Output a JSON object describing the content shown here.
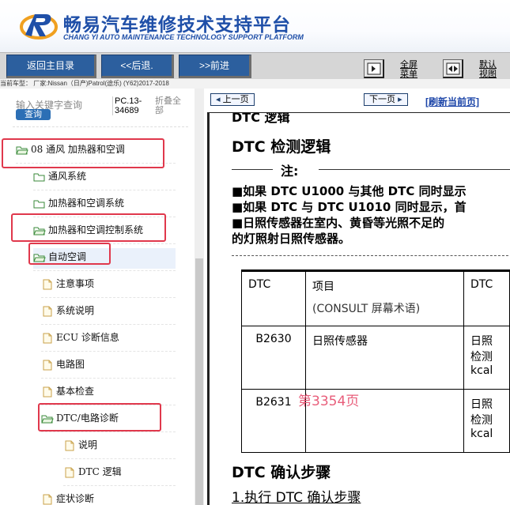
{
  "header": {
    "title": "畅易汽车维修技术支持平台",
    "subtitle": "CHANG YI AUTO MAINTENANCE TECHNOLOGY SUPPORT PLATFORM"
  },
  "toolbar": {
    "home_label": "返回主目录",
    "back_label": "<<后退.",
    "forward_label": ">>前进",
    "fullscreen_label": "全屏",
    "menu_label": "菜单",
    "default_label": "默认",
    "view_label": "视图"
  },
  "vehicle_info": "当前车型： 厂家:Nissan（日产)Patrol(途乐) (Y62)2017-2018",
  "search": {
    "placeholder": "输入关键字查询",
    "button_label": "查询"
  },
  "doc_code": "PC.13-34689",
  "collapse_label": "折叠全部",
  "tree": [
    {
      "label": "08 通风 加热器和空调",
      "level": 0,
      "open": true,
      "highlight": true
    },
    {
      "label": "通风系统",
      "level": 1,
      "open": false,
      "highlight": false
    },
    {
      "label": "加热器和空调系统",
      "level": 1,
      "open": false,
      "highlight": false
    },
    {
      "label": "加热器和空调控制系统",
      "level": 1,
      "open": true,
      "highlight": true
    },
    {
      "label": "自动空调",
      "level": 2,
      "open": true,
      "highlight": true,
      "selected": true
    },
    {
      "label": "注意事项",
      "level": 3,
      "file": true
    },
    {
      "label": "系统说明",
      "level": 3,
      "file": true
    },
    {
      "label": "ECU 诊断信息",
      "level": 3,
      "file": true
    },
    {
      "label": "电路图",
      "level": 3,
      "file": true
    },
    {
      "label": "基本检查",
      "level": 3,
      "file": true
    },
    {
      "label": "DTC/电路诊断",
      "level": 3,
      "open": true,
      "highlight": true
    },
    {
      "label": "说明",
      "level": 4,
      "file": true
    },
    {
      "label": "DTC 逻辑",
      "level": 4,
      "file": true
    },
    {
      "label": "症状诊断",
      "level": 3,
      "file": true
    }
  ],
  "pager": {
    "prev_label": "上一页",
    "next_label": "下一页",
    "refresh_label": "[刷新当前页]"
  },
  "document": {
    "partial_heading": "DTC 逻辑",
    "heading": "DTC 检测逻辑",
    "note_label": "注:",
    "bullets": [
      "■如果 DTC U1000 与其他 DTC 同时显示",
      "■如果 DTC 与 DTC U1010 同时显示，首",
      "■日照传感器在室内、黄昏等光照不足的",
      "  的灯照射日照传感器。"
    ],
    "table": {
      "headers": [
        "DTC",
        "项目",
        "DTC"
      ],
      "header_sub": "(CONSULT 屏幕术语)",
      "rows": [
        {
          "dtc": "B2630",
          "item": "日照传感器",
          "detail1": "日照",
          "detail2": "检测",
          "detail3": "kcal"
        },
        {
          "dtc": "B2631",
          "item": "",
          "detail1": "日照",
          "detail2": "检测",
          "detail3": "kcal"
        }
      ]
    },
    "page_watermark": "第3354页",
    "section2": "DTC 确认步骤",
    "section2_sub": "1.执行 DTC 确认步骤"
  },
  "colors": {
    "brand_blue": "#1f4fa8",
    "button_blue": "#2c5f9e",
    "highlight_red": "#e0384c",
    "watermark_pink": "#e85d7a"
  }
}
